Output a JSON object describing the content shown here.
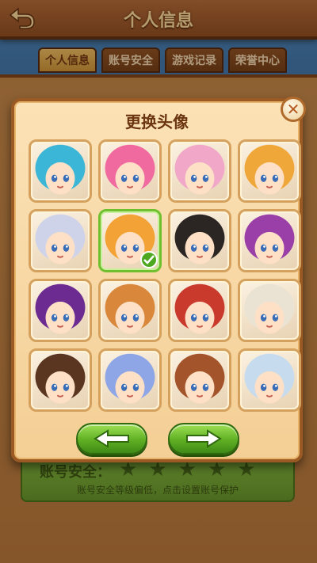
{
  "header": {
    "title": "个人信息",
    "back_icon": "back-arrow-icon"
  },
  "tabs": [
    {
      "label": "个人信息",
      "active": true
    },
    {
      "label": "账号安全",
      "active": false
    },
    {
      "label": "游戏记录",
      "active": false
    },
    {
      "label": "荣誉中心",
      "active": false
    }
  ],
  "security": {
    "title": "账号安全：",
    "stars_filled": 0,
    "stars_total": 5,
    "description": "账号安全等级偏低，点击设置账号保护"
  },
  "modal": {
    "title": "更换头像",
    "close_icon": "close-icon",
    "selected_index": 5,
    "avatars": [
      {
        "hair": "#3bb6d6"
      },
      {
        "hair": "#f06aa0"
      },
      {
        "hair": "#f1a7c8"
      },
      {
        "hair": "#f0a73a"
      },
      {
        "hair": "#cfd3ea"
      },
      {
        "hair": "#f3a236"
      },
      {
        "hair": "#2b2623"
      },
      {
        "hair": "#9a3fa8"
      },
      {
        "hair": "#6c2b91"
      },
      {
        "hair": "#d9873a"
      },
      {
        "hair": "#c93a2c"
      },
      {
        "hair": "#eae3d3"
      },
      {
        "hair": "#5a3520"
      },
      {
        "hair": "#8ea6e6"
      },
      {
        "hair": "#a3542a"
      },
      {
        "hair": "#c6dbee"
      }
    ],
    "prev_icon": "arrow-left-icon",
    "next_icon": "arrow-right-icon"
  },
  "colors": {
    "wood": "#9b5a24",
    "panel": "#f4cf95",
    "accent_green": "#5faf23",
    "title_brown": "#6b3511"
  }
}
